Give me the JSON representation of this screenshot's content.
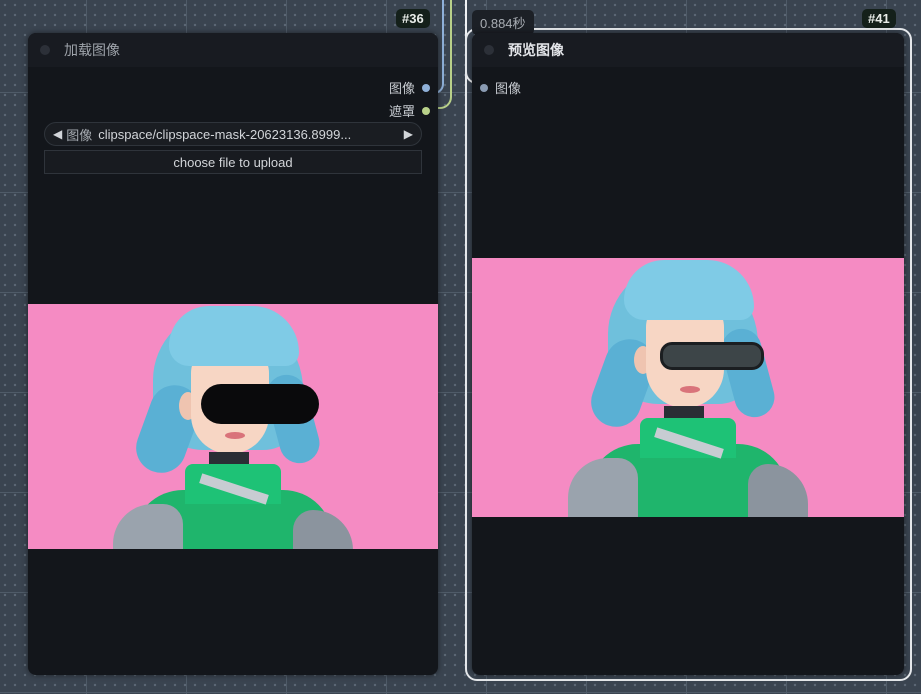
{
  "nodes": [
    {
      "id_badge": "#36",
      "title": "加载图像",
      "outputs": [
        {
          "label": "图像",
          "color": "#8fb0d8"
        },
        {
          "label": "遮罩",
          "color": "#b9d18a"
        }
      ],
      "widgets": {
        "image_combo": {
          "label": "图像",
          "value": "clipspace/clipspace-mask-20623136.8999...",
          "prev_arrow": "◀",
          "next_arrow": "▶"
        },
        "upload_button": "choose file to upload"
      },
      "preview": {
        "description": "anime character with blue hair, eyes masked by black bar, pink background"
      }
    },
    {
      "id_badge": "#41",
      "title": "预览图像",
      "execution_time": "0.884秒",
      "selected": true,
      "inputs": [
        {
          "label": "图像",
          "color": "#8a9bb2"
        }
      ],
      "preview": {
        "description": "anime character with blue hair wearing dark glasses, pink background"
      }
    }
  ],
  "links": [
    {
      "from": "#36 图像",
      "to": "#41 图像",
      "color": "#8fb0d8"
    },
    {
      "from": "#36 遮罩",
      "to": "offscreen",
      "color": "#b9d18a"
    }
  ]
}
